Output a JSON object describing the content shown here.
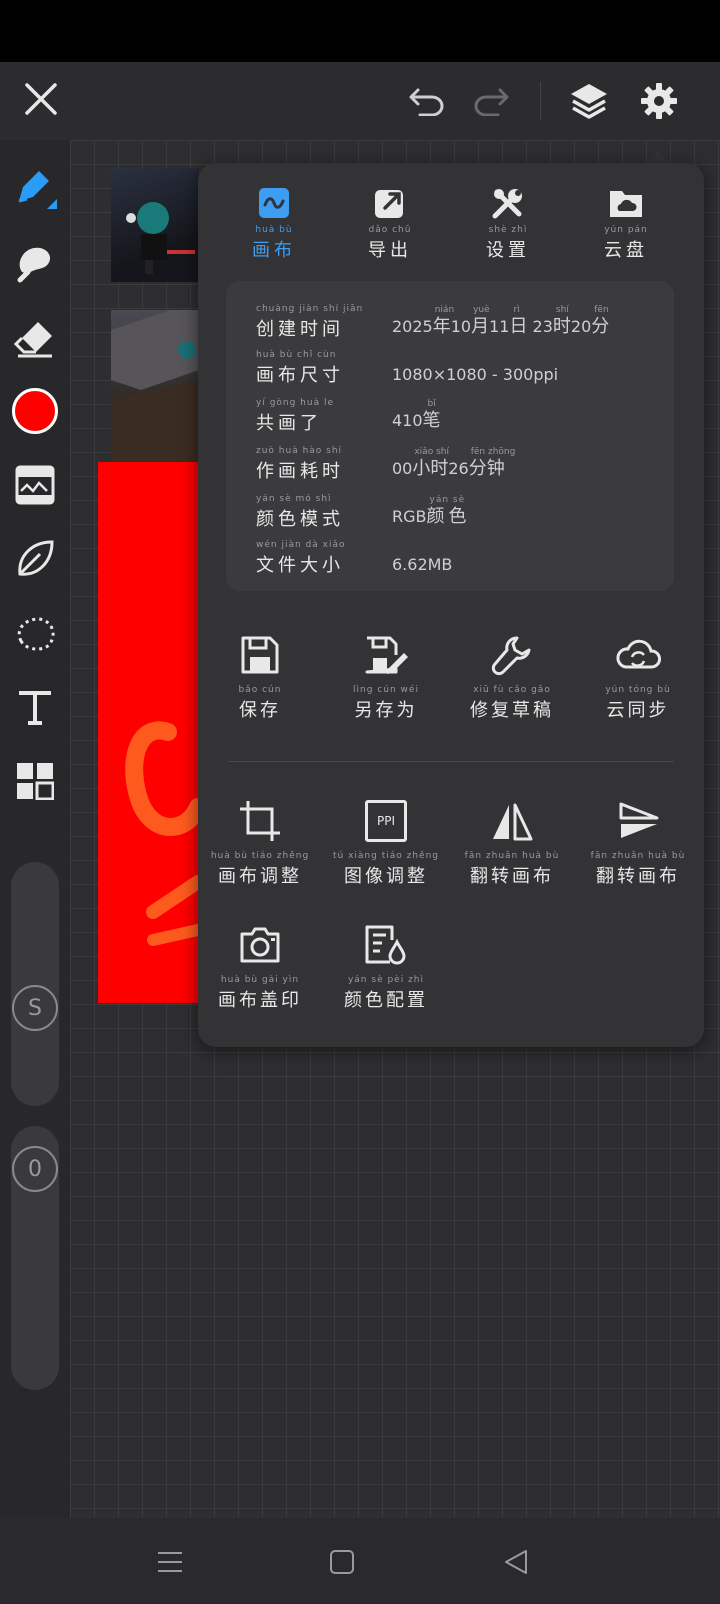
{
  "top_bar": {
    "close_icon": "close-icon",
    "undo_icon": "undo-icon",
    "redo_icon": "redo-icon",
    "layers_icon": "layers-icon",
    "settings_icon": "gear-icon"
  },
  "left_toolbar": {
    "tools": [
      "pen-icon",
      "smudge-icon",
      "eraser-icon",
      "color-swatch",
      "filter-icon",
      "leaf-icon",
      "lasso-icon",
      "text-icon",
      "grid-icon"
    ],
    "active_color": "#ff0000",
    "size_slider_label": "S",
    "opacity_slider_label": "0"
  },
  "panel": {
    "tabs": [
      {
        "pinyin": "huà  bù",
        "label": "画布",
        "icon": "canvas-icon",
        "active": true
      },
      {
        "pinyin": "dǎo  chū",
        "label": "导出",
        "icon": "export-icon",
        "active": false
      },
      {
        "pinyin": "shè  zhì",
        "label": "设置",
        "icon": "tools-icon",
        "active": false
      },
      {
        "pinyin": "yún  pán",
        "label": "云盘",
        "icon": "cloud-folder-icon",
        "active": false
      }
    ],
    "info": [
      {
        "pinyin": "chuàng jiàn  shí  jiān",
        "label": "创建时间",
        "value_parts": [
          "2025",
          "年",
          "10",
          "月",
          "11",
          "日",
          " 23",
          "时",
          "20",
          "分"
        ],
        "value_pinyin": [
          "",
          "nián",
          "",
          "yuè",
          "",
          "rì",
          "",
          "shí",
          "",
          "fēn"
        ]
      },
      {
        "pinyin": "huà  bù  chǐ  cùn",
        "label": "画布尺寸",
        "value": "1080×1080 - 300ppi"
      },
      {
        "pinyin": "yí  gòng  huà  le",
        "label": "共画了",
        "value_parts": [
          "410",
          "笔"
        ],
        "value_pinyin": [
          "",
          "bǐ"
        ]
      },
      {
        "pinyin": "zuò  huà  hào  shí",
        "label": "作画耗时",
        "value_parts": [
          "00",
          "小时",
          "26",
          "分钟"
        ],
        "value_pinyin": [
          "",
          "xiǎo  shí",
          "",
          "fēn zhōng"
        ]
      },
      {
        "pinyin": "yán  sè  mó  shì",
        "label": "颜色模式",
        "value_parts": [
          "RGB",
          "颜色"
        ],
        "value_pinyin": [
          "",
          "yán  sè"
        ]
      },
      {
        "pinyin": "wén  jiàn  dà  xiǎo",
        "label": "文件大小",
        "value": "6.62MB"
      }
    ],
    "actions_row1": [
      {
        "pinyin": "bǎo  cún",
        "label": "保存",
        "icon": "save-icon"
      },
      {
        "pinyin": "lìng  cún  wéi",
        "label": "另存为",
        "icon": "save-as-icon"
      },
      {
        "pinyin": "xiū  fù  cǎo  gǎo",
        "label": "修复草稿",
        "icon": "wrench-icon"
      },
      {
        "pinyin": "yún  tóng  bù",
        "label": "云同步",
        "icon": "cloud-sync-icon"
      }
    ],
    "actions_row2": [
      {
        "pinyin": "huà  bù  tiáo zhěng",
        "label": "画布调整",
        "icon": "crop-icon"
      },
      {
        "pinyin": "tú  xiàng  tiáo zhěng",
        "label": "图像调整",
        "icon": "ppi-icon",
        "icon_text": "PPI"
      },
      {
        "pinyin": "fān  zhuǎn  huà  bù",
        "label": "翻转画布",
        "icon": "flip-horizontal-icon"
      },
      {
        "pinyin": "fān  zhuǎn  huà  bù",
        "label": "翻转画布",
        "icon": "flip-vertical-icon"
      }
    ],
    "actions_row3": [
      {
        "pinyin": "huà  bù  gài  yìn",
        "label": "画布盖印",
        "icon": "camera-icon"
      },
      {
        "pinyin": "yán  sè  pèi  zhì",
        "label": "颜色配置",
        "icon": "color-profile-icon"
      }
    ]
  },
  "colors": {
    "accent_blue": "#3d9df2",
    "canvas_red": "#ff0000"
  },
  "nav_bar": [
    "menu-icon",
    "home-icon",
    "back-icon"
  ]
}
